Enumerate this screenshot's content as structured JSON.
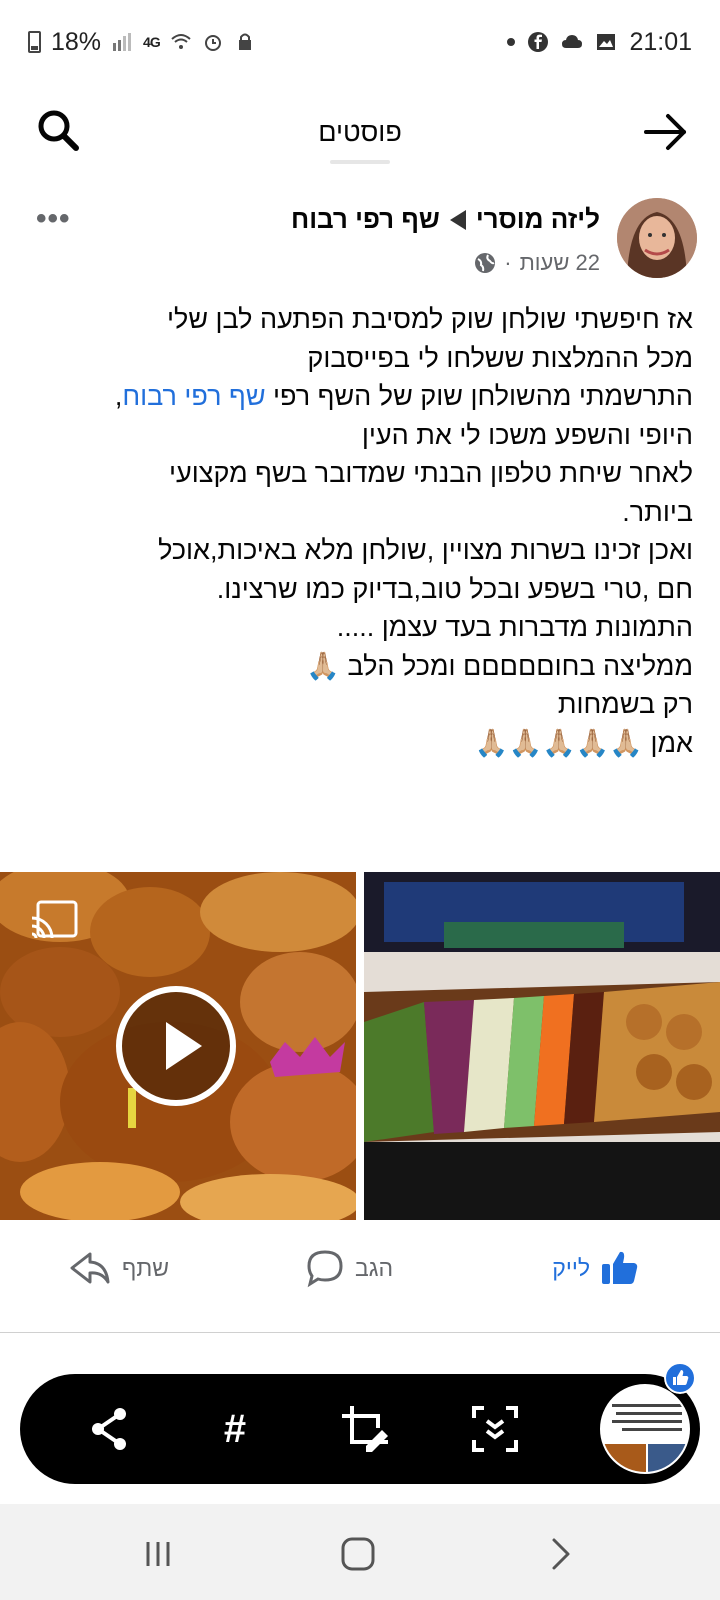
{
  "status_bar": {
    "battery": "18%",
    "network": "4G",
    "time": "21:01"
  },
  "header": {
    "title": "פוסטים",
    "back_icon": "arrow-right-icon",
    "search_icon": "search-icon"
  },
  "post": {
    "author": "ליזה מוסרי",
    "page": "שף רפי רבוח",
    "time": "22 שעות",
    "separator": "·",
    "privacy_icon": "globe-icon",
    "more": "•••",
    "lines": [
      {
        "text": "אז חיפשתי שולחן שוק למסיבת הפתעה לבן שלי"
      },
      {
        "text": "מכל ההמלצות ששלחו לי בפייסבוק"
      },
      {
        "pre": "התרשמתי מהשולחן שוק של השף רפי ",
        "mention": "שף רפי רבוח",
        "post": ","
      },
      {
        "text": "היופי והשפע משכו לי את העין"
      },
      {
        "text": "לאחר שיחת טלפון הבנתי שמדובר בשף מקצועי"
      },
      {
        "text": "ביותר."
      },
      {
        "text": "ואכן זכינו בשרות מצויין ,שולחן מלא באיכות,אוכל"
      },
      {
        "text": "חם ,טרי בשפע ובכל  טוב,בדיוק כמו שרצינו."
      },
      {
        "text": "התמונות מדברות בעד עצמן ....."
      },
      {
        "text": "ממליצה בחוםםםםם ומכל הלב 🙏🏼"
      },
      {
        "text": "רק בשמחות"
      },
      {
        "text": "אמן 🙏🏼🙏🏼🙏🏼🙏🏼🙏🏼"
      }
    ]
  },
  "actions": {
    "like": "לייק",
    "comment": "הגב",
    "share": "שתף"
  },
  "toolbar": {
    "share_icon": "share-icon",
    "hashtag": "#",
    "crop_icon": "crop-edit-icon",
    "scroll_capture_icon": "scroll-capture-icon"
  },
  "colors": {
    "accent": "#216fdb",
    "text": "#050505",
    "muted": "#65676b"
  }
}
